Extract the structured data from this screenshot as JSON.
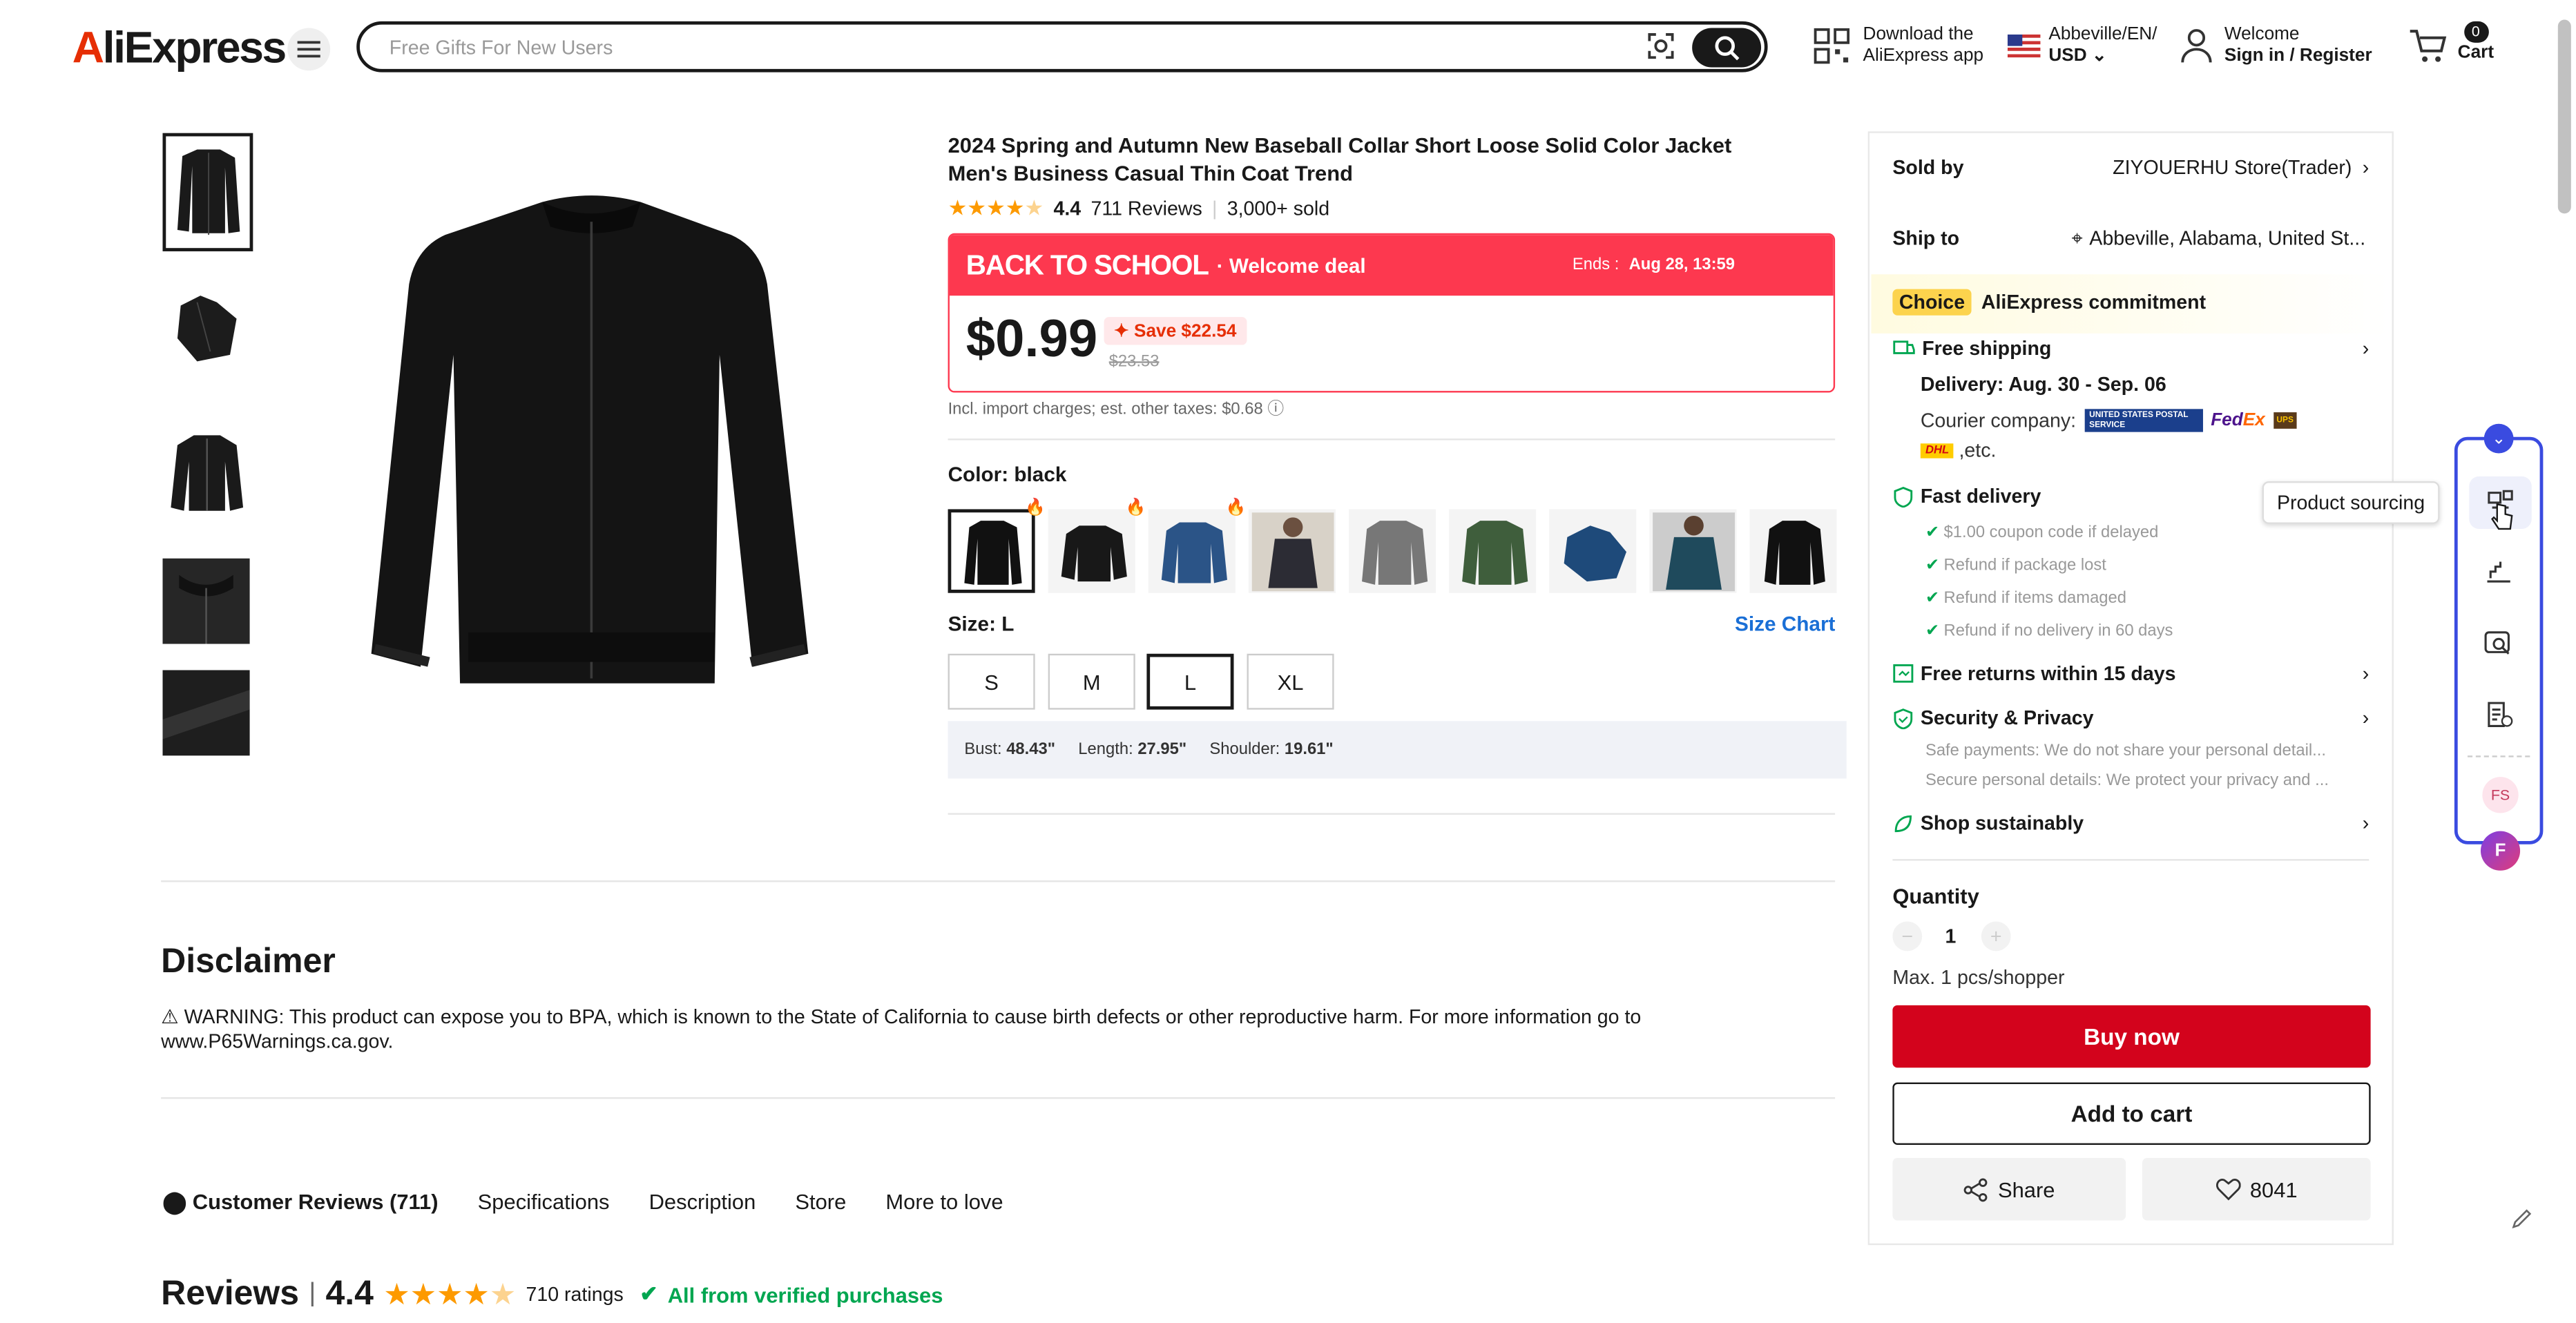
{
  "header": {
    "logo": "AliExpress",
    "search_placeholder": "Free Gifts For New Users",
    "download_line1": "Download the",
    "download_line2": "AliExpress app",
    "region_line1": "Abbeville/EN/",
    "region_line2": "USD",
    "welcome": "Welcome",
    "sign_in": "Sign in / Register",
    "cart_count": "0",
    "cart_label": "Cart"
  },
  "product": {
    "title": "2024 Spring and Autumn New Baseball Collar Short Loose Solid Color Jacket Men's Business Casual Thin Coat Trend",
    "rating": "4.4",
    "reviews": "711 Reviews",
    "sold": "3,000+ sold",
    "banner_title": "BACK TO SCHOOL",
    "banner_sub": "· Welcome deal",
    "ends_label": "Ends :",
    "ends_time": "Aug 28, 13:59",
    "price": "$0.99",
    "save": "Save $22.54",
    "original_price": "$23.53",
    "tax_note": "Incl. import charges; est. other taxes: $0.68",
    "color_label": "Color: black",
    "size_label": "Size: L",
    "size_chart": "Size Chart",
    "sizes": [
      "S",
      "M",
      "L",
      "XL"
    ],
    "measure": {
      "bust_label": "Bust:",
      "bust": "48.43\"",
      "length_label": "Length:",
      "length": "27.95\"",
      "shoulder_label": "Shoulder:",
      "shoulder": "19.61\""
    }
  },
  "panel": {
    "sold_by_label": "Sold by",
    "store": "ZIYOUERHU Store(Trader)",
    "ship_to_label": "Ship to",
    "ship_to": "Abbeville, Alabama, United St...",
    "choice": "Choice",
    "commitment": "AliExpress commitment",
    "free_shipping": "Free shipping",
    "delivery": "Delivery: Aug. 30 - Sep. 06",
    "courier_label": "Courier company:",
    "courier_etc": ",etc.",
    "usps": "UNITED STATES POSTAL SERVICE",
    "fedex_a": "Fed",
    "fedex_b": "Ex",
    "ups": "UPS",
    "dhl": "DHL",
    "fast_delivery": "Fast delivery",
    "fast_items": [
      "$1.00 coupon code if delayed",
      "Refund if package lost",
      "Refund if items damaged",
      "Refund if no delivery in 60 days"
    ],
    "free_returns": "Free returns within 15 days",
    "security": "Security & Privacy",
    "security_items": [
      "Safe payments: We do not share your personal detail...",
      "Secure personal details: We protect your privacy and ..."
    ],
    "sustainably": "Shop sustainably",
    "quantity_label": "Quantity",
    "quantity": "1",
    "max": "Max. 1 pcs/shopper",
    "buy_now": "Buy now",
    "add_to_cart": "Add to cart",
    "share": "Share",
    "likes": "8041"
  },
  "sidebar_float": {
    "tooltip": "Product sourcing",
    "fs": "FS"
  },
  "disclaimer": {
    "title": "Disclaimer",
    "body": "⚠ WARNING: This product can expose you to BPA, which is known to the State of California to cause birth defects or other reproductive harm. For more information go to www.P65Warnings.ca.gov."
  },
  "tabs": [
    "Customer Reviews (711)",
    "Specifications",
    "Description",
    "Store",
    "More to love"
  ],
  "reviews": {
    "title": "Reviews",
    "score": "4.4",
    "ratings": "710 ratings",
    "verified": "All from verified purchases"
  }
}
